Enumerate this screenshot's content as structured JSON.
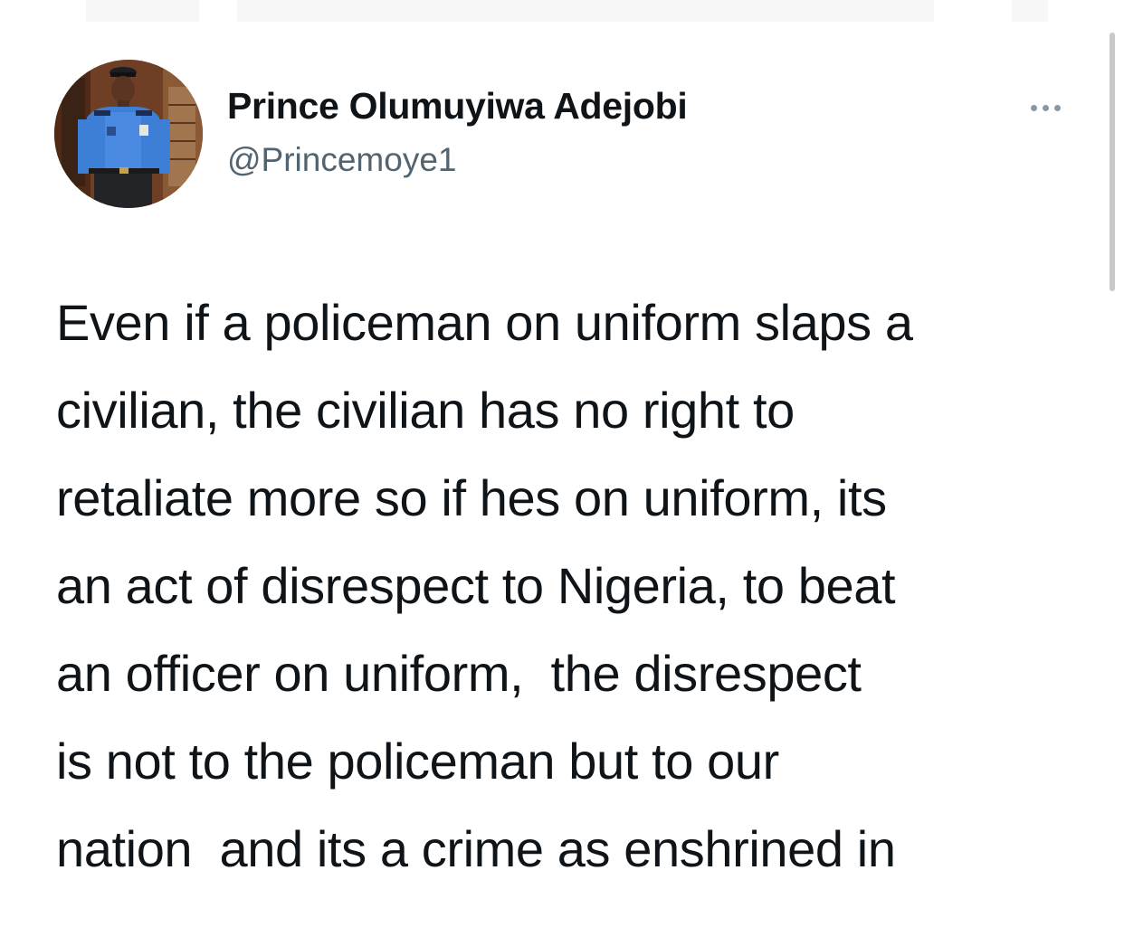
{
  "author": {
    "display_name": "Prince Olumuyiwa Adejobi",
    "handle": "@Princemoye1",
    "avatar_description_icon": "avatar-photo"
  },
  "menu": {
    "icon": "more-dots-icon"
  },
  "tweet": {
    "lines": [
      "Even if a policeman on uniform slaps a",
      "civilian, the civilian has no right to",
      "retaliate more so if hes on uniform, its",
      "an act of disrespect to Nigeria, to beat",
      "an officer on uniform,  the disrespect",
      "is not to the policeman but to our",
      "nation  and its a crime as enshrined in"
    ]
  },
  "colors": {
    "text": "#0f1419",
    "secondary": "#536471",
    "background": "#ffffff"
  }
}
